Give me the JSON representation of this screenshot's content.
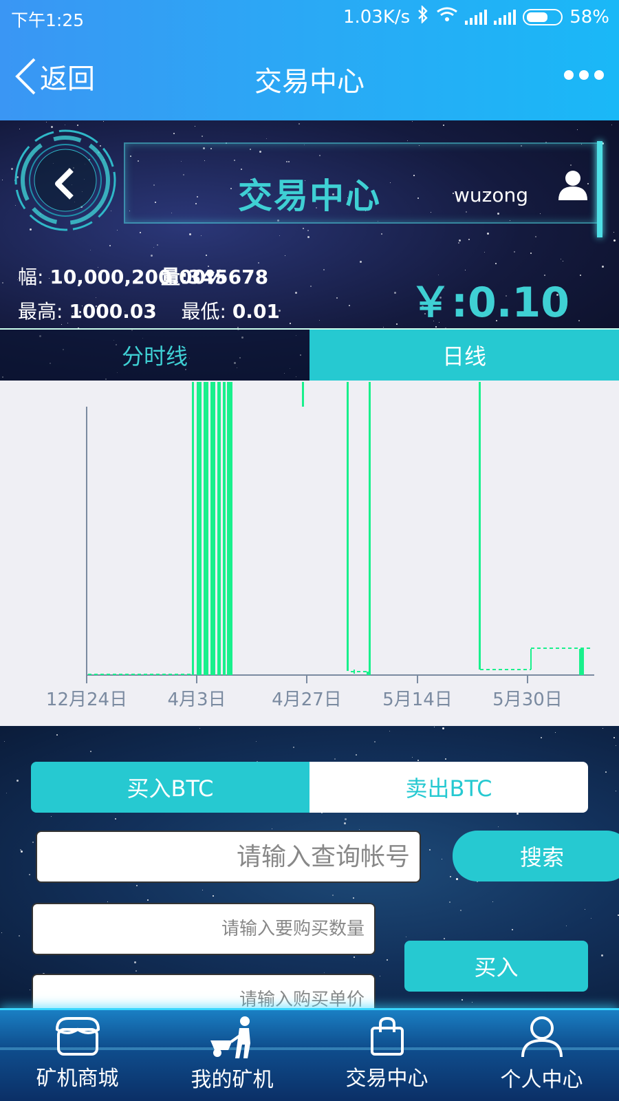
{
  "status_bar": {
    "time": "下午1:25",
    "net_speed": "1.03K/s",
    "battery": "58%"
  },
  "nav": {
    "back_label": "返回",
    "title": "交易中心"
  },
  "hero": {
    "title": "交易中心",
    "username": "wuzong",
    "stat_line1_label": "幅:",
    "stat_line1_value": "10,000,200.00%",
    "stat_line1_overlap": "量:345678",
    "high_label": "最高:",
    "high_value": "1000.03",
    "low_label": "最低:",
    "low_value": "0.01",
    "price": "￥:0.10"
  },
  "chart_tabs": {
    "minute": "分时线",
    "daily": "日线"
  },
  "chart_data": {
    "type": "bar",
    "categories": [
      "12月24日",
      "4月3日",
      "4月27日",
      "5月14日",
      "5月30日"
    ],
    "title": "",
    "xlabel": "",
    "ylabel": "",
    "grid": false,
    "colors": {
      "bar": "#19f08c",
      "axis": "#7a8aa0"
    }
  },
  "trade": {
    "buy_tab": "买入BTC",
    "sell_tab": "卖出BTC",
    "account_placeholder": "请输入查询帐号",
    "search_button": "搜索",
    "qty_placeholder": "请输入要购买数量",
    "price_placeholder": "请输入购买单价",
    "buy_button": "买入"
  },
  "bottom_nav": [
    {
      "label": "矿机商城",
      "icon": "store-icon"
    },
    {
      "label": "我的矿机",
      "icon": "miner-icon"
    },
    {
      "label": "交易中心",
      "icon": "bag-icon"
    },
    {
      "label": "个人中心",
      "icon": "person-icon"
    }
  ],
  "colors": {
    "accent": "#26c9d1",
    "header": "#2aa9f5"
  }
}
